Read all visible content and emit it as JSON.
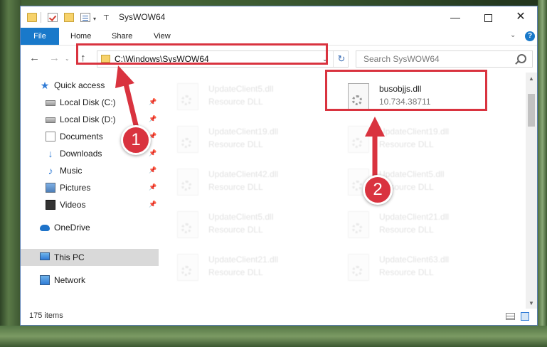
{
  "window": {
    "title": "SysWOW64",
    "controls": {
      "minimize": "—",
      "maximize": "",
      "close": "✕"
    }
  },
  "quick_access_toolbar": {
    "dropdown": "▾",
    "pin": "⊤"
  },
  "ribbon": {
    "tabs": [
      "File",
      "Home",
      "Share",
      "View"
    ],
    "expand": "⌄",
    "help": "?"
  },
  "nav": {
    "back": "←",
    "forward": "→",
    "history": "⌄",
    "up": "↑",
    "address": "C:\\Windows\\SysWOW64",
    "address_dropdown": "⌄",
    "refresh": "↻",
    "search_placeholder": "Search SysWOW64"
  },
  "sidebar": {
    "items": [
      {
        "label": "Quick access",
        "icon": "star-icon",
        "pinned": false
      },
      {
        "label": "Local Disk (C:)",
        "icon": "drive-icon",
        "pinned": true
      },
      {
        "label": "Local Disk (D:)",
        "icon": "drive-icon",
        "pinned": true
      },
      {
        "label": "Documents",
        "icon": "documents-icon",
        "pinned": true
      },
      {
        "label": "Downloads",
        "icon": "download-icon",
        "pinned": true
      },
      {
        "label": "Music",
        "icon": "music-icon",
        "pinned": true
      },
      {
        "label": "Pictures",
        "icon": "pictures-icon",
        "pinned": true
      },
      {
        "label": "Videos",
        "icon": "videos-icon",
        "pinned": true
      },
      {
        "label": "OneDrive",
        "icon": "cloud-icon",
        "pinned": false
      },
      {
        "label": "This PC",
        "icon": "computer-icon",
        "pinned": false,
        "selected": true
      },
      {
        "label": "Network",
        "icon": "network-icon",
        "pinned": false
      }
    ],
    "pin_glyph": "📌"
  },
  "files": {
    "left_column": [
      {
        "name": "UpdateClient5.dll",
        "desc": "Resource DLL"
      },
      {
        "name": "UpdateClient19.dll",
        "desc": "Resource DLL"
      },
      {
        "name": "UpdateClient42.dll",
        "desc": "Resource DLL"
      },
      {
        "name": "UpdateClient5.dll",
        "desc": "Resource DLL"
      },
      {
        "name": "UpdateClient21.dll",
        "desc": "Resource DLL"
      }
    ],
    "right_column": [
      {
        "name": "busobjjs.dll",
        "desc": "10.734.38711",
        "highlighted": true
      },
      {
        "name": "UpdateClient19.dll",
        "desc": "Resource DLL"
      },
      {
        "name": "UpdateClient5.dll",
        "desc": "Resource DLL"
      },
      {
        "name": "UpdateClient21.dll",
        "desc": "Resource DLL"
      },
      {
        "name": "UpdateClient63.dll",
        "desc": "Resource DLL"
      }
    ]
  },
  "status": {
    "item_count": "175 items"
  },
  "annotations": {
    "step1": "1",
    "step2": "2",
    "accent_color": "#d9333f"
  }
}
